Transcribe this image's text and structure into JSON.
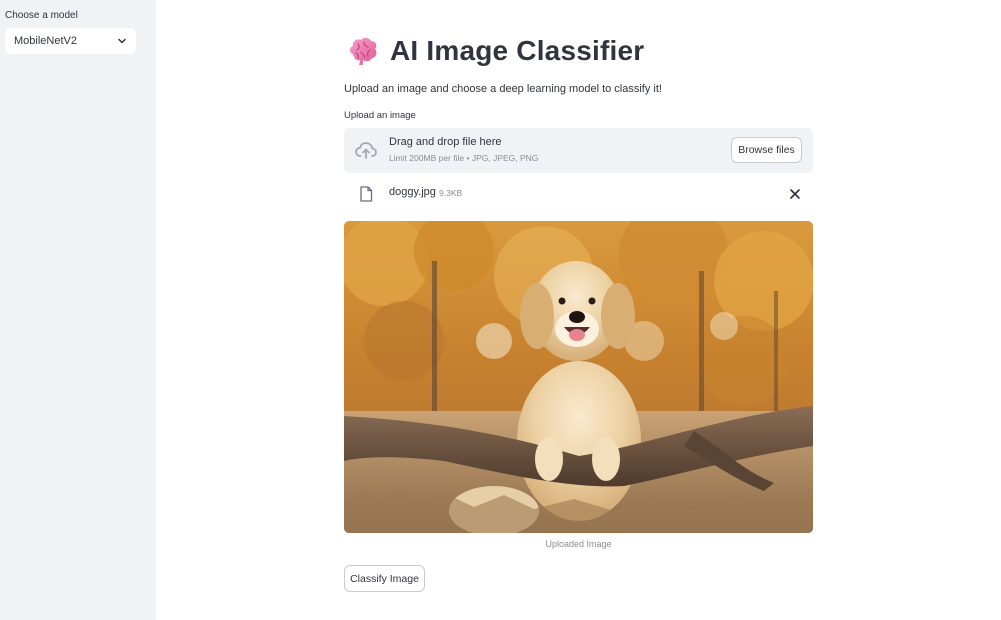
{
  "sidebar": {
    "model_label": "Choose a model",
    "model_selected": "MobileNetV2"
  },
  "main": {
    "title": "AI Image Classifier",
    "title_icon": "brain-icon",
    "subtitle": "Upload an image and choose a deep learning model to classify it!",
    "upload_label": "Upload an image",
    "dropzone": {
      "text": "Drag and drop file here",
      "limit": "Limit 200MB per file • JPG, JPEG, PNG",
      "browse_label": "Browse files",
      "icon": "cloud-upload-icon"
    },
    "file": {
      "name": "doggy.jpg",
      "size": "9.3KB",
      "icon": "file-icon",
      "remove_icon": "close-icon"
    },
    "image_caption": "Uploaded Image",
    "classify_label": "Classify Image"
  },
  "colors": {
    "sidebar_bg": "#f0f2f6",
    "text": "#31333f",
    "muted": "#8b8d96",
    "border": "#c9cbd1"
  }
}
